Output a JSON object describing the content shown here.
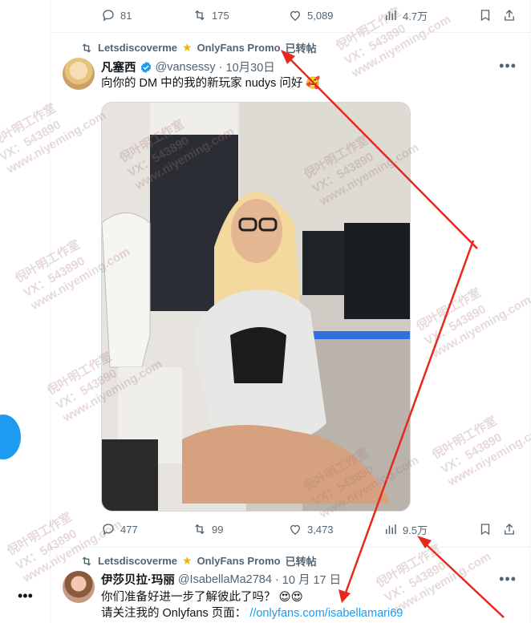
{
  "top_actions": {
    "reply": "81",
    "retweet": "175",
    "like": "5,089",
    "views": "4.7万"
  },
  "tweet1": {
    "repost_by": "Letsdiscoverme",
    "repost_tag": "OnlyFans Promo",
    "repost_suffix": "已转帖",
    "name": "凡塞西",
    "handle": "@vansessy",
    "date": "10月30日",
    "text": "向你的 DM 中的我的新玩家 nudys 问好",
    "emoji": "🥰",
    "actions": {
      "reply": "477",
      "retweet": "99",
      "like": "3,473",
      "views": "9.5万"
    }
  },
  "tweet2": {
    "repost_by": "Letsdiscoverme",
    "repost_tag": "OnlyFans Promo",
    "repost_suffix": "已转帖",
    "name": "伊莎贝拉·玛丽",
    "handle": "@IsabellaMa2784",
    "date": "10 月 17 日",
    "line1": "你们准备好进一步了解彼此了吗？",
    "line1_emoji": "😍😍",
    "line2": "请关注我的 Onlyfans 页面：",
    "link": "//onlyfans.com/isabellamari69"
  },
  "watermark": {
    "line1": "倪叶明工作室",
    "line2": "VX：543890",
    "line3": "www.niyeming.com"
  },
  "colors": {
    "accent": "#1d9bf0",
    "muted": "#536471",
    "annotation": "#e8281c"
  }
}
